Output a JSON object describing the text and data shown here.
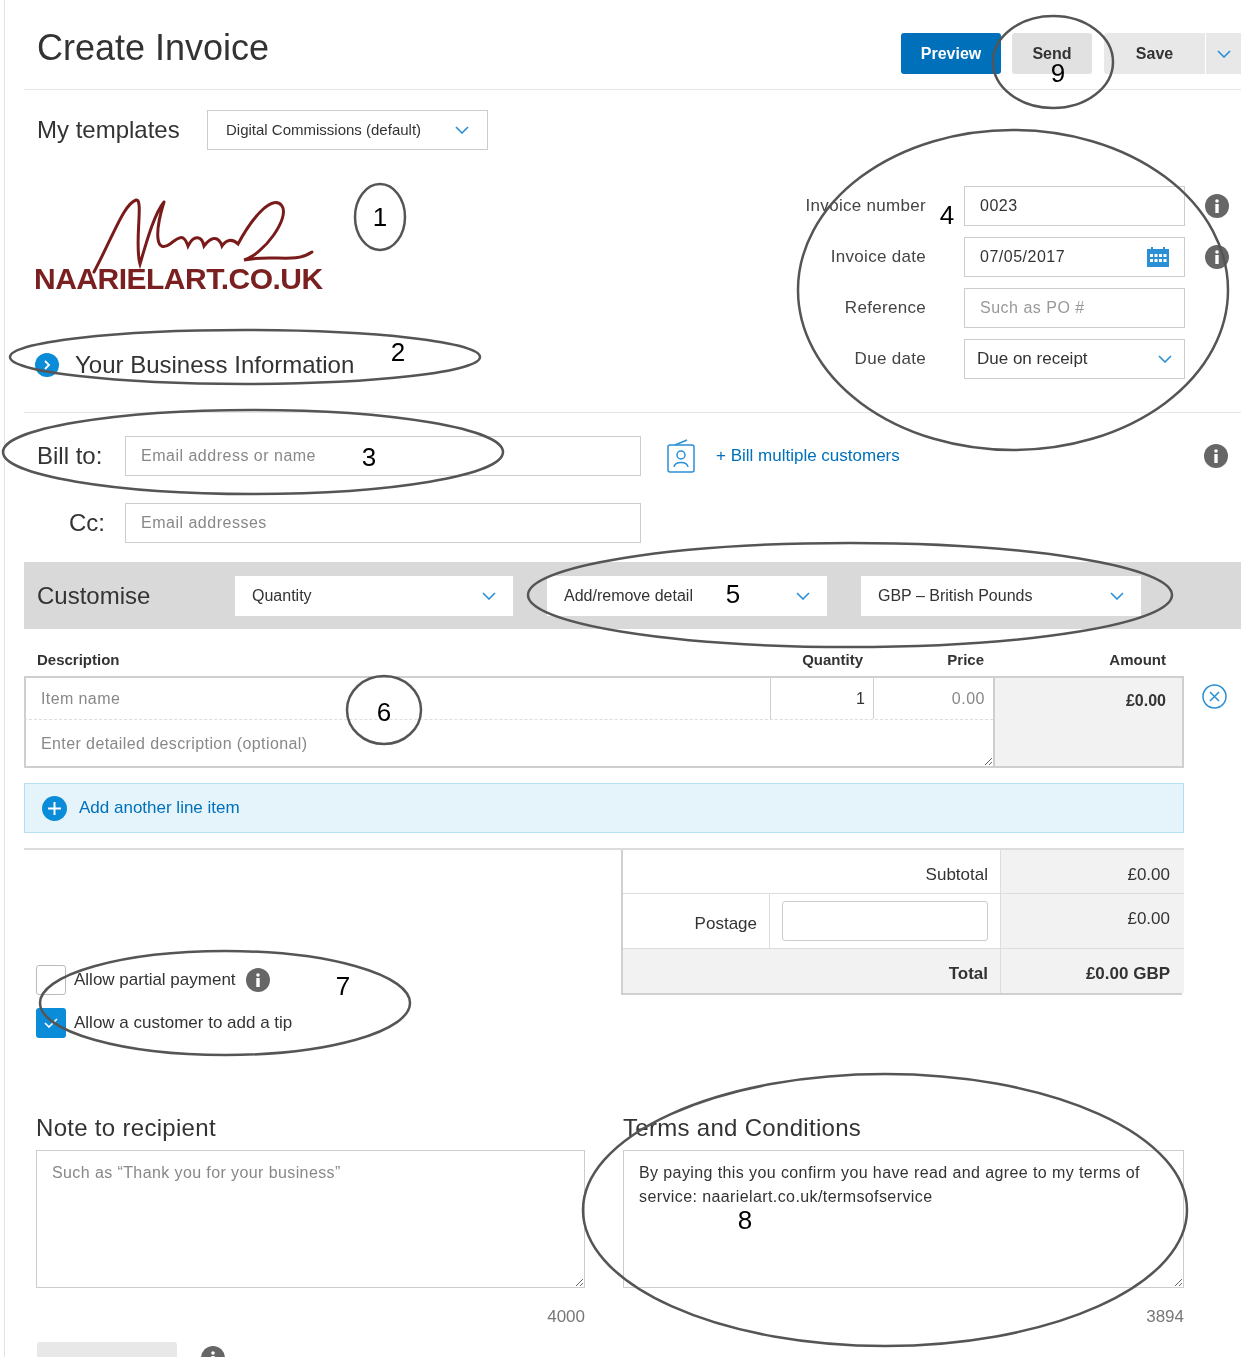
{
  "header": {
    "title": "Create Invoice",
    "buttons": [
      {
        "label": "Preview",
        "kind": "primary"
      },
      {
        "label": "Send",
        "kind": "secondary"
      },
      {
        "label": "Save",
        "kind": "split"
      }
    ]
  },
  "templates": {
    "label": "My templates",
    "value": "Digital Commissions (default)"
  },
  "logo": {
    "text": "NAARIELART.CO.UK"
  },
  "business_info": {
    "label": "Your Business Information",
    "expanded": false
  },
  "invoice_fields": [
    {
      "label": "Invoice number",
      "value": "0023",
      "kind": "text",
      "info": true
    },
    {
      "label": "Invoice date",
      "value": "07/05/2017",
      "kind": "date",
      "info": true
    },
    {
      "label": "Reference",
      "placeholder": "Such as PO #",
      "kind": "text",
      "info": false
    },
    {
      "label": "Due date",
      "value": "Due on receipt",
      "kind": "select",
      "info": false
    }
  ],
  "bill_to": {
    "label": "Bill to:",
    "placeholder": "Email address or name",
    "link": "+ Bill multiple customers"
  },
  "cc": {
    "label": "Cc:",
    "placeholder": "Email addresses"
  },
  "customise": {
    "label": "Customise",
    "selects": [
      "Quantity",
      "Add/remove detail",
      "GBP – British Pounds"
    ]
  },
  "items_table": {
    "columns": [
      "Description",
      "Quantity",
      "Price",
      "Amount"
    ],
    "rows": [
      {
        "name_placeholder": "Item name",
        "description_placeholder": "Enter detailed description (optional)",
        "quantity": "1",
        "price_placeholder": "0.00",
        "amount": "£0.00"
      }
    ]
  },
  "add_line": "Add another line item",
  "totals": {
    "subtotal_label": "Subtotal",
    "subtotal": "£0.00",
    "postage_label": "Postage",
    "postage": "£0.00",
    "total_label": "Total",
    "total": "£0.00 GBP"
  },
  "options": [
    {
      "label": "Allow partial payment",
      "checked": false,
      "info": true
    },
    {
      "label": "Allow a customer to add a tip",
      "checked": true,
      "info": false
    }
  ],
  "note": {
    "heading": "Note to recipient",
    "placeholder": "Such as “Thank you for your business”",
    "count": "4000"
  },
  "terms": {
    "heading": "Terms and Conditions",
    "value": "By paying this you confirm you have read and agree to my terms of service: naarielart.co.uk/termsofservice",
    "count": "3894"
  },
  "annotations": [
    {
      "label": "1"
    },
    {
      "label": "2"
    },
    {
      "label": "3"
    },
    {
      "label": "4"
    },
    {
      "label": "5"
    },
    {
      "label": "6"
    },
    {
      "label": "7"
    },
    {
      "label": "8"
    },
    {
      "label": "9"
    }
  ]
}
